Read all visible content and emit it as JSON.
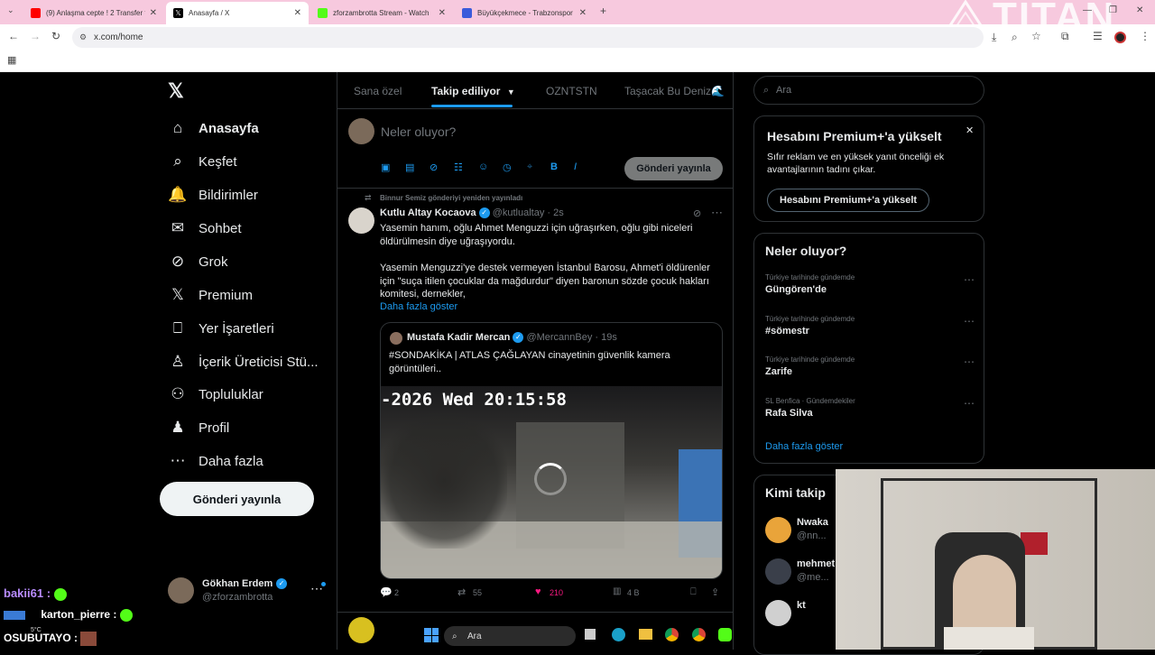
{
  "browser": {
    "tabs": [
      {
        "title": "(9) Anlaşma cepte ! 2 Transfer t",
        "color": "#ff0000"
      },
      {
        "title": "Anasayfa / X",
        "color": "#000000"
      },
      {
        "title": "zforzambrotta Stream - Watch",
        "color": "#53fc18"
      },
      {
        "title": "Büyükçekmece - Trabzonspor",
        "color": "#3b5bdb"
      }
    ],
    "url": "x.com/home",
    "overlay_logo": "TITAN"
  },
  "nav": {
    "items": [
      {
        "label": "Anasayfa",
        "icon": "home-icon",
        "glyph": "⌂"
      },
      {
        "label": "Keşfet",
        "icon": "search-icon",
        "glyph": "⌕"
      },
      {
        "label": "Bildirimler",
        "icon": "bell-icon",
        "glyph": "🔔"
      },
      {
        "label": "Sohbet",
        "icon": "mail-icon",
        "glyph": "✉"
      },
      {
        "label": "Grok",
        "icon": "grok-icon",
        "glyph": "⊘"
      },
      {
        "label": "Premium",
        "icon": "x-icon",
        "glyph": "𝕏"
      },
      {
        "label": "Yer İşaretleri",
        "icon": "bookmark-icon",
        "glyph": "⎕"
      },
      {
        "label": "İçerik Üreticisi Stü...",
        "icon": "creator-icon",
        "glyph": "♙"
      },
      {
        "label": "Topluluklar",
        "icon": "communities-icon",
        "glyph": "⚇"
      },
      {
        "label": "Profil",
        "icon": "profile-icon",
        "glyph": "♟"
      },
      {
        "label": "Daha fazla",
        "icon": "more-icon",
        "glyph": "⋯"
      }
    ],
    "post_button": "Gönderi yayınla",
    "account": {
      "name": "Gökhan Erdem",
      "handle": "@zforzambrotta"
    }
  },
  "center": {
    "tabs": [
      "Sana özel",
      "Takip ediliyor",
      "OZNTSTN",
      "Taşacak Bu Deniz🌊"
    ],
    "composer_placeholder": "Neler oluyor?",
    "composer_button": "Gönderi yayınla",
    "tweet": {
      "repost_note": "Binnur Semiz gönderiyi yeniden yayınladı",
      "author": "Kutlu Altay Kocaova",
      "handle": "@kutlualtay",
      "time": "2s",
      "text1": "Yasemin hanım, oğlu Ahmet Menguzzi için uğraşırken, oğlu gibi niceleri öldürülmesin diye uğraşıyordu.",
      "text2": "Yasemin Menguzzi'ye destek vermeyen İstanbul Barosu, Ahmet'i öldürenler için \"suça itilen çocuklar da mağdurdur\" diyen baronun sözde çocuk hakları komitesi, dernekler,",
      "show_more": "Daha fazla göster",
      "quote": {
        "author": "Mustafa Kadir Mercan",
        "handle": "@MercannBey",
        "time": "19s",
        "text": "#SONDAKİKA | ATLAS ÇAĞLAYAN cinayetinin güvenlik kamera görüntüleri..",
        "timestamp_overlay": "-2026 Wed 20:15:58"
      },
      "stats": {
        "replies": "2",
        "reposts": "55",
        "likes": "210",
        "views": "4 B"
      }
    }
  },
  "right": {
    "search_placeholder": "Ara",
    "premium": {
      "title": "Hesabını Premium+'a yükselt",
      "body": "Sıfır reklam ve en yüksek yanıt önceliği ek avantajlarının tadını çıkar.",
      "button": "Hesabını Premium+'a yükselt"
    },
    "trends": {
      "title": "Neler oluyor?",
      "items": [
        {
          "category": "Türkiye tarihinde gündemde",
          "name": "Güngören'de"
        },
        {
          "category": "Türkiye tarihinde gündemde",
          "name": "#sömestr"
        },
        {
          "category": "Türkiye tarihinde gündemde",
          "name": "Zarife"
        },
        {
          "category": "SL Benfica · Gündemdekiler",
          "name": "Rafa Silva"
        }
      ],
      "show_more": "Daha fazla göster"
    },
    "who_to_follow": {
      "title": "Kimi takip",
      "items": [
        {
          "name": "Nwaka",
          "handle": "@nn..."
        },
        {
          "name": "mehmet",
          "handle": "@me..."
        },
        {
          "name": "kt",
          "handle": ""
        }
      ]
    }
  },
  "overlay_chat": [
    {
      "user": "bakii61 :"
    },
    {
      "user": "karton_pierre :"
    },
    {
      "user": "OSUBUTAYO :"
    }
  ],
  "taskbar": {
    "search": "Ara",
    "temp": "5°C"
  }
}
